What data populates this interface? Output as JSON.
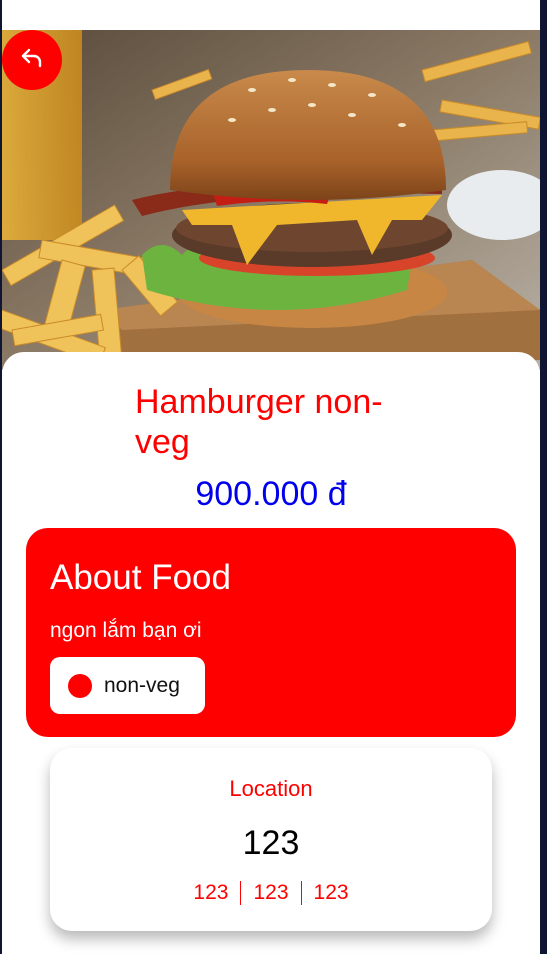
{
  "product": {
    "name": "Hamburger non-veg",
    "price": "900.000 đ",
    "image_icon": "burger-photo"
  },
  "navigation": {
    "back_icon": "back-arrow-icon"
  },
  "about": {
    "heading": "About Food",
    "description": "ngon lắm bạn ơi",
    "tag_label": "non-veg"
  },
  "location": {
    "title": "Location",
    "value": "123",
    "details": [
      "123",
      "123",
      "123"
    ]
  },
  "colors": {
    "accent": "#ff0000",
    "price": "#0000ee",
    "frame": "#0f1633"
  }
}
